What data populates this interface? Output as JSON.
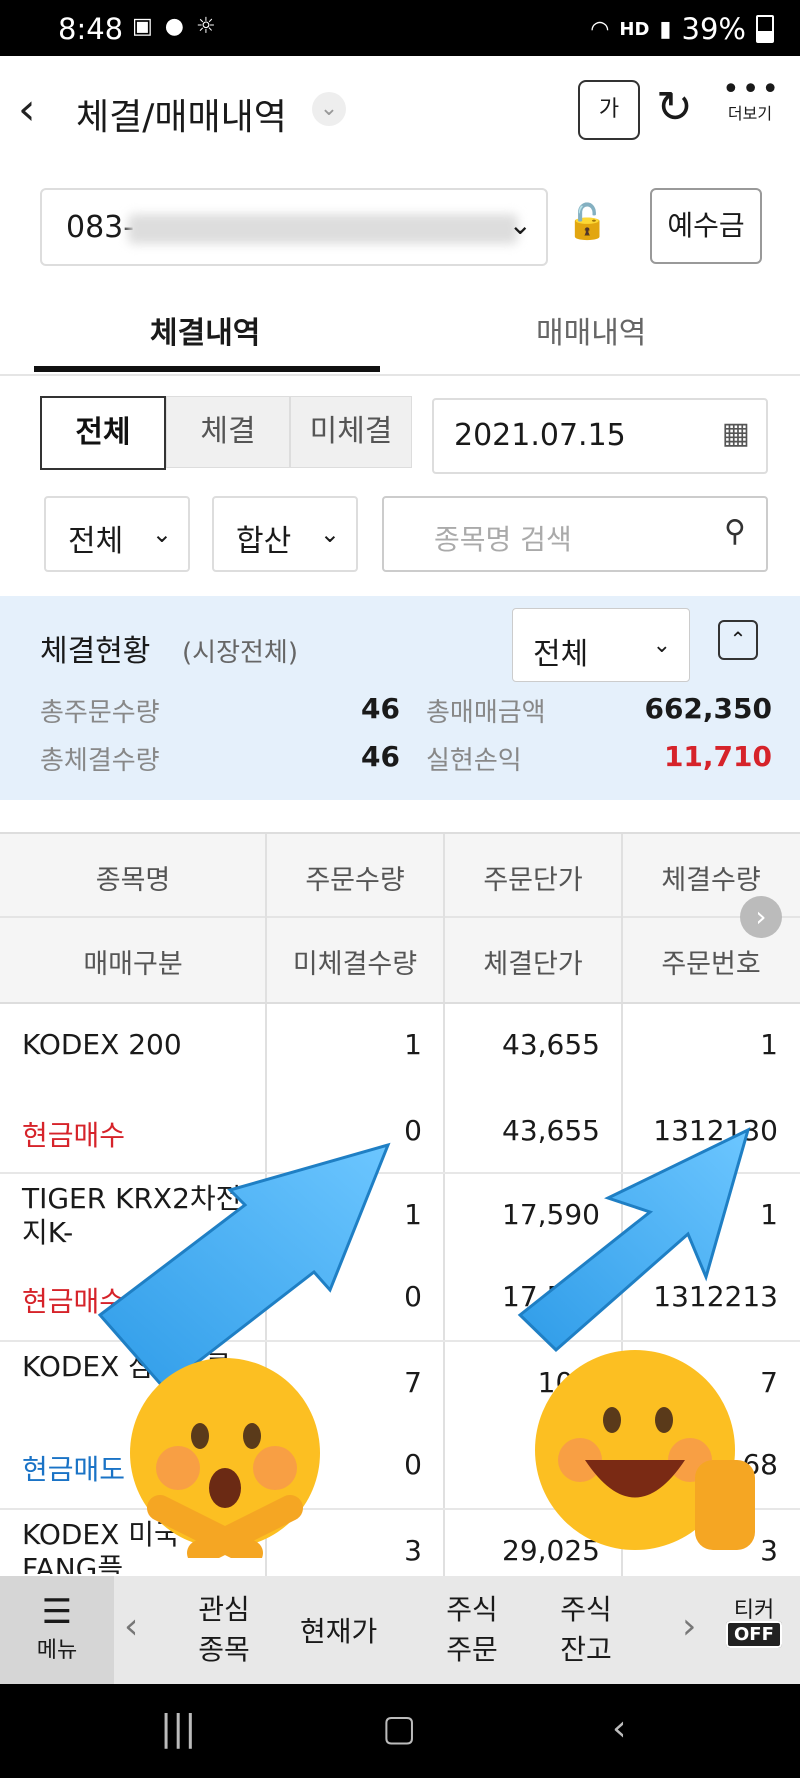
{
  "status": {
    "time": "8:48",
    "battery": "39%",
    "network": "HD"
  },
  "header": {
    "title": "체결/매매내역",
    "font_btn": "가",
    "more_label": "더보기"
  },
  "account": {
    "number_prefix": "083-",
    "deposit_btn": "예수금"
  },
  "tabs": [
    "체결내역",
    "매매내역"
  ],
  "filters": {
    "segments": [
      "전체",
      "체결",
      "미체결"
    ],
    "date": "2021.07.15",
    "type_select": "전체",
    "sum_select": "합산",
    "search_placeholder": "종목명 검색"
  },
  "summary": {
    "title": "체결현황",
    "subtitle": "(시장전체)",
    "select": "전체",
    "total_order_qty_label": "총주문수량",
    "total_order_qty": "46",
    "total_trade_amount_label": "총매매금액",
    "total_trade_amount": "662,350",
    "total_exec_qty_label": "총체결수량",
    "total_exec_qty": "46",
    "realized_pl_label": "실현손익",
    "realized_pl": "11,710"
  },
  "table": {
    "header_row1": [
      "종목명",
      "주문수량",
      "주문단가",
      "체결수량"
    ],
    "header_row2": [
      "매매구분",
      "미체결수량",
      "체결단가",
      "주문번호"
    ],
    "rows": [
      {
        "name": "KODEX 200",
        "order_qty": "1",
        "order_price": "43,655",
        "exec_qty": "1",
        "side": "현금매수",
        "unexec_qty": "0",
        "exec_price": "43,655",
        "order_no": "1312130"
      },
      {
        "name": "TIGER KRX2차전지K-",
        "order_qty": "1",
        "order_price": "17,590",
        "exec_qty": "1",
        "side": "현금매수",
        "unexec_qty": "0",
        "exec_price": "17,590",
        "order_no": "1312213"
      },
      {
        "name": "KODEX 삼성그룹",
        "order_qty": "7",
        "order_price": "10,5",
        "exec_qty": "7",
        "side": "현금매도",
        "unexec_qty": "0",
        "exec_price": "10",
        "order_no": "68"
      },
      {
        "name": "KODEX 미국FANG플",
        "order_qty": "3",
        "order_price": "29,025",
        "exec_qty": "3",
        "side": "",
        "unexec_qty": "",
        "exec_price": "",
        "order_no": ""
      }
    ]
  },
  "bottomnav": {
    "menu": "메뉴",
    "items": [
      "관심 종목",
      "현재가",
      "주식 주문",
      "주식 잔고"
    ],
    "ticker": "티커",
    "ticker_state": "OFF"
  },
  "colors": {
    "buy": "#d6232a",
    "sell": "#1a73c6",
    "summary_bg": "#e5f0fb"
  }
}
